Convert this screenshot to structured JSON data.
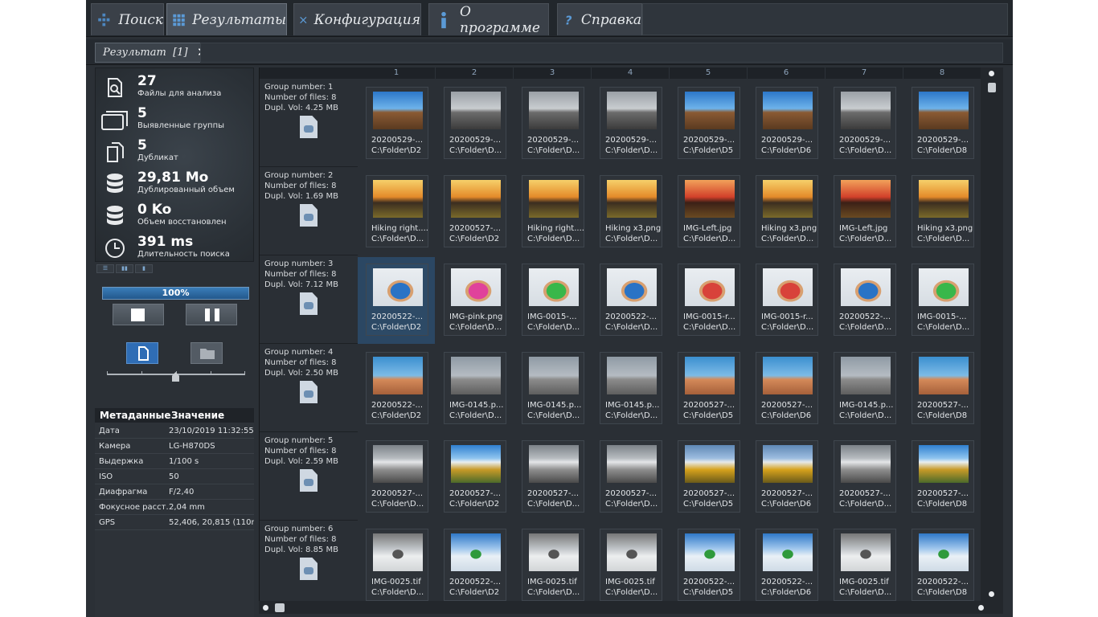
{
  "tabs": [
    {
      "label": "Поиск",
      "icon": "search-grid-icon"
    },
    {
      "label": "Результаты",
      "icon": "results-grid-icon"
    },
    {
      "label": "Конфигурация",
      "icon": "wrench-icon"
    },
    {
      "label": "О программе",
      "icon": "info-icon"
    },
    {
      "label": "Справка",
      "icon": "help-icon"
    }
  ],
  "result_tab": {
    "label": "Результат  [1]",
    "close": "✕"
  },
  "stats": [
    {
      "value": "27",
      "label": "Файлы для анализа",
      "icon": "file-search-icon"
    },
    {
      "value": "5",
      "label": "Выявленные группы",
      "icon": "groups-icon"
    },
    {
      "value": "5",
      "label": "Дубликат",
      "icon": "duplicate-icon"
    },
    {
      "value": "29,81 Mo",
      "label": "Дублированный объем",
      "icon": "database-icon"
    },
    {
      "value": "0 Ko",
      "label": "Объем восстановлен",
      "icon": "database-recover-icon"
    },
    {
      "value": "391 ms",
      "label": "Длительность поиска",
      "icon": "clock-icon"
    }
  ],
  "progress": {
    "label": "100%",
    "value": 100
  },
  "slider": {
    "value": 0.5
  },
  "metadata": {
    "headers": [
      "Метаданные",
      "Значение"
    ],
    "rows": [
      {
        "key": "Дата",
        "value": "23/10/2019 11:32:55"
      },
      {
        "key": "Камера",
        "value": "LG-H870DS"
      },
      {
        "key": "Выдержка",
        "value": "1/100 s"
      },
      {
        "key": "ISO",
        "value": "50"
      },
      {
        "key": "Диафрагма",
        "value": "F/2,40"
      },
      {
        "key": "Фокусное расст.",
        "value": "2,04 mm"
      },
      {
        "key": "GPS",
        "value": "52,406, 20,815 (110m"
      }
    ]
  },
  "columns": [
    "1",
    "2",
    "3",
    "4",
    "5",
    "6",
    "7",
    "8"
  ],
  "groups": [
    {
      "number": "Group number: 1",
      "files": "Number of files: 8",
      "vol": "Dupl. Vol: 4.25 MB",
      "cells": [
        {
          "name": "20200529-...",
          "path": "C:\\Folder\\D2",
          "img": "p-sky"
        },
        {
          "name": "20200529-...",
          "path": "C:\\Folder\\D...",
          "img": "p-grey"
        },
        {
          "name": "20200529-...",
          "path": "C:\\Folder\\D...",
          "img": "p-grey"
        },
        {
          "name": "20200529-...",
          "path": "C:\\Folder\\D...",
          "img": "p-grey"
        },
        {
          "name": "20200529-...",
          "path": "C:\\Folder\\D5",
          "img": "p-sky"
        },
        {
          "name": "20200529-...",
          "path": "C:\\Folder\\D6",
          "img": "p-sky"
        },
        {
          "name": "20200529-...",
          "path": "C:\\Folder\\D...",
          "img": "p-grey"
        },
        {
          "name": "20200529-...",
          "path": "C:\\Folder\\D8",
          "img": "p-sky"
        }
      ]
    },
    {
      "number": "Group number: 2",
      "files": "Number of files: 8",
      "vol": "Dupl. Vol: 1.69 MB",
      "cells": [
        {
          "name": "Hiking right....",
          "path": "C:\\Folder\\D...",
          "img": "p-sunset"
        },
        {
          "name": "20200527-...",
          "path": "C:\\Folder\\D2",
          "img": "p-sunset"
        },
        {
          "name": "Hiking right....",
          "path": "C:\\Folder\\D...",
          "img": "p-sunset"
        },
        {
          "name": "Hiking x3.png",
          "path": "C:\\Folder\\D...",
          "img": "p-sunset"
        },
        {
          "name": "IMG-Left.jpg",
          "path": "C:\\Folder\\D...",
          "img": "p-red"
        },
        {
          "name": "Hiking x3.png",
          "path": "C:\\Folder\\D...",
          "img": "p-sunset"
        },
        {
          "name": "IMG-Left.jpg",
          "path": "C:\\Folder\\D...",
          "img": "p-red"
        },
        {
          "name": "Hiking x3.png",
          "path": "C:\\Folder\\D...",
          "img": "p-sunset"
        }
      ]
    },
    {
      "number": "Group number: 3",
      "files": "Number of files: 8",
      "vol": "Dupl. Vol: 7.12 MB",
      "cells": [
        {
          "name": "20200522-...",
          "path": "C:\\Folder\\D2",
          "img": "p-blue-j",
          "selected": true
        },
        {
          "name": "IMG-pink.png",
          "path": "C:\\Folder\\D...",
          "img": "p-pink-j"
        },
        {
          "name": "IMG-0015-...",
          "path": "C:\\Folder\\D...",
          "img": "p-green-j"
        },
        {
          "name": "20200522-...",
          "path": "C:\\Folder\\D...",
          "img": "p-blue-j"
        },
        {
          "name": "IMG-0015-r...",
          "path": "C:\\Folder\\D...",
          "img": "p-red-j"
        },
        {
          "name": "IMG-0015-r...",
          "path": "C:\\Folder\\D...",
          "img": "p-red-j"
        },
        {
          "name": "20200522-...",
          "path": "C:\\Folder\\D...",
          "img": "p-blue-j"
        },
        {
          "name": "IMG-0015-...",
          "path": "C:\\Folder\\D...",
          "img": "p-green-j"
        }
      ]
    },
    {
      "number": "Group number: 4",
      "files": "Number of files: 8",
      "vol": "Dupl. Vol: 2.50 MB",
      "cells": [
        {
          "name": "20200522-...",
          "path": "C:\\Folder\\D2",
          "img": "p-lake"
        },
        {
          "name": "IMG-0145.p...",
          "path": "C:\\Folder\\D...",
          "img": "p-lake-g"
        },
        {
          "name": "IMG-0145.p...",
          "path": "C:\\Folder\\D...",
          "img": "p-lake-g"
        },
        {
          "name": "IMG-0145.p...",
          "path": "C:\\Folder\\D...",
          "img": "p-lake-g"
        },
        {
          "name": "20200527-...",
          "path": "C:\\Folder\\D5",
          "img": "p-lake"
        },
        {
          "name": "20200527-...",
          "path": "C:\\Folder\\D6",
          "img": "p-lake"
        },
        {
          "name": "IMG-0145.p...",
          "path": "C:\\Folder\\D...",
          "img": "p-lake-g"
        },
        {
          "name": "20200527-...",
          "path": "C:\\Folder\\D8",
          "img": "p-lake"
        }
      ]
    },
    {
      "number": "Group number: 5",
      "files": "Number of files: 8",
      "vol": "Dupl. Vol: 2.59 MB",
      "cells": [
        {
          "name": "20200527-...",
          "path": "C:\\Folder\\D...",
          "img": "p-mtn-g"
        },
        {
          "name": "20200527-...",
          "path": "C:\\Folder\\D2",
          "img": "p-mtn"
        },
        {
          "name": "20200527-...",
          "path": "C:\\Folder\\D...",
          "img": "p-mtn-g"
        },
        {
          "name": "20200527-...",
          "path": "C:\\Folder\\D...",
          "img": "p-mtn-g"
        },
        {
          "name": "20200527-...",
          "path": "C:\\Folder\\D5",
          "img": "p-mtn-o"
        },
        {
          "name": "20200527-...",
          "path": "C:\\Folder\\D6",
          "img": "p-mtn-o"
        },
        {
          "name": "20200527-...",
          "path": "C:\\Folder\\D...",
          "img": "p-mtn-g"
        },
        {
          "name": "20200527-...",
          "path": "C:\\Folder\\D8",
          "img": "p-mtn"
        }
      ]
    },
    {
      "number": "Group number: 6",
      "files": "Number of files: 8",
      "vol": "Dupl. Vol: 8.85 MB",
      "cells": [
        {
          "name": "IMG-0025.tif",
          "path": "C:\\Folder\\D...",
          "img": "p-snow-g"
        },
        {
          "name": "20200522-...",
          "path": "C:\\Folder\\D2",
          "img": "p-snow"
        },
        {
          "name": "IMG-0025.tif",
          "path": "C:\\Folder\\D...",
          "img": "p-snow-g"
        },
        {
          "name": "IMG-0025.tif",
          "path": "C:\\Folder\\D...",
          "img": "p-snow-g"
        },
        {
          "name": "20200522-...",
          "path": "C:\\Folder\\D5",
          "img": "p-snow"
        },
        {
          "name": "20200522-...",
          "path": "C:\\Folder\\D6",
          "img": "p-snow"
        },
        {
          "name": "IMG-0025.tif",
          "path": "C:\\Folder\\D...",
          "img": "p-snow-g"
        },
        {
          "name": "20200522-...",
          "path": "C:\\Folder\\D8",
          "img": "p-snow"
        }
      ]
    }
  ]
}
